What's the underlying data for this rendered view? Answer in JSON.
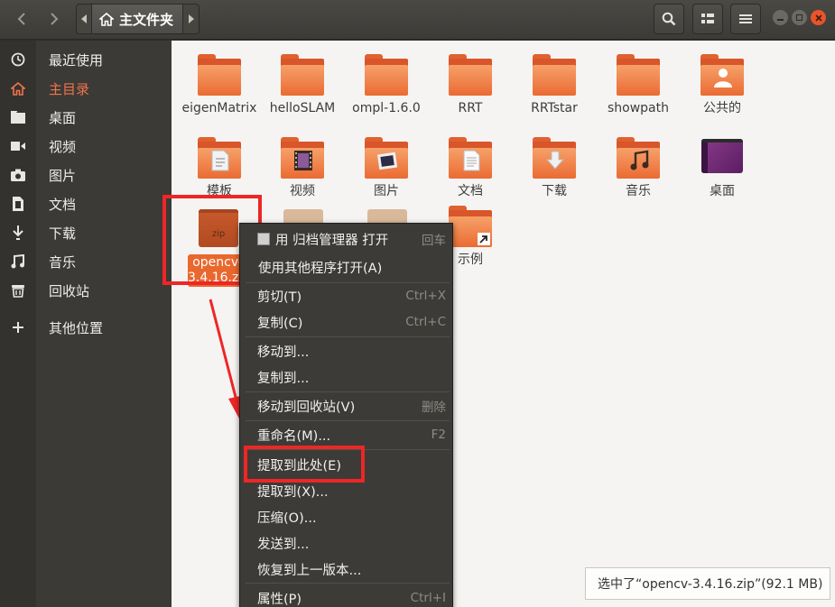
{
  "header": {
    "path_label": "主文件夹"
  },
  "sidebar": {
    "items": [
      {
        "label": "最近使用",
        "icon": "clock-icon"
      },
      {
        "label": "主目录",
        "icon": "home-icon",
        "active": true
      },
      {
        "label": "桌面",
        "icon": "folder-icon"
      },
      {
        "label": "视频",
        "icon": "video-icon"
      },
      {
        "label": "图片",
        "icon": "camera-icon"
      },
      {
        "label": "文档",
        "icon": "document-icon"
      },
      {
        "label": "下载",
        "icon": "download-icon"
      },
      {
        "label": "音乐",
        "icon": "music-icon"
      },
      {
        "label": "回收站",
        "icon": "trash-icon"
      },
      {
        "label": "其他位置",
        "icon": "plus-icon"
      }
    ]
  },
  "files": [
    {
      "name": "eigenMatrix",
      "type": "folder"
    },
    {
      "name": "helloSLAM",
      "type": "folder"
    },
    {
      "name": "ompl-1.6.0",
      "type": "folder"
    },
    {
      "name": "RRT",
      "type": "folder"
    },
    {
      "name": "RRTstar",
      "type": "folder"
    },
    {
      "name": "showpath",
      "type": "folder"
    },
    {
      "name": "公共的",
      "type": "folder-public"
    },
    {
      "name": "模板",
      "type": "folder-templates"
    },
    {
      "name": "视频",
      "type": "folder-videos"
    },
    {
      "name": "图片",
      "type": "folder-pictures"
    },
    {
      "name": "文档",
      "type": "folder-documents"
    },
    {
      "name": "下载",
      "type": "folder-downloads"
    },
    {
      "name": "音乐",
      "type": "folder-music"
    },
    {
      "name": "桌面",
      "type": "folder-desktop"
    },
    {
      "name": "opencv-3.4.16.zip",
      "type": "zip",
      "selected": true,
      "icon_text": "zip"
    },
    {
      "name": "示例",
      "type": "folder-link"
    }
  ],
  "selected_label_lines": [
    "opencv-",
    "3.4.16.zip"
  ],
  "context_menu": {
    "items": [
      {
        "label": "用 归档管理器 打开",
        "shortcut": "回车"
      },
      {
        "label": "使用其他程序打开(A)",
        "shortcut": ""
      },
      {
        "label": "剪切(T)",
        "shortcut": "Ctrl+X"
      },
      {
        "label": "复制(C)",
        "shortcut": "Ctrl+C"
      },
      {
        "label": "移动到...",
        "shortcut": ""
      },
      {
        "label": "复制到...",
        "shortcut": ""
      },
      {
        "label": "移动到回收站(V)",
        "shortcut": "删除"
      },
      {
        "label": "重命名(M)...",
        "shortcut": "F2"
      },
      {
        "label": "提取到此处(E)",
        "shortcut": ""
      },
      {
        "label": "提取到(X)...",
        "shortcut": ""
      },
      {
        "label": "压缩(O)...",
        "shortcut": ""
      },
      {
        "label": "发送到...",
        "shortcut": ""
      },
      {
        "label": "恢复到上一版本...",
        "shortcut": ""
      },
      {
        "label": "属性(P)",
        "shortcut": "Ctrl+I"
      }
    ]
  },
  "status": {
    "text": "选中了“opencv-3.4.16.zip”(92.1 MB)"
  },
  "colors": {
    "accent": "#e95420",
    "highlight_box": "#ee2626",
    "menu_bg": "#3c3b37",
    "sidebar_bg": "#3b3a36"
  }
}
